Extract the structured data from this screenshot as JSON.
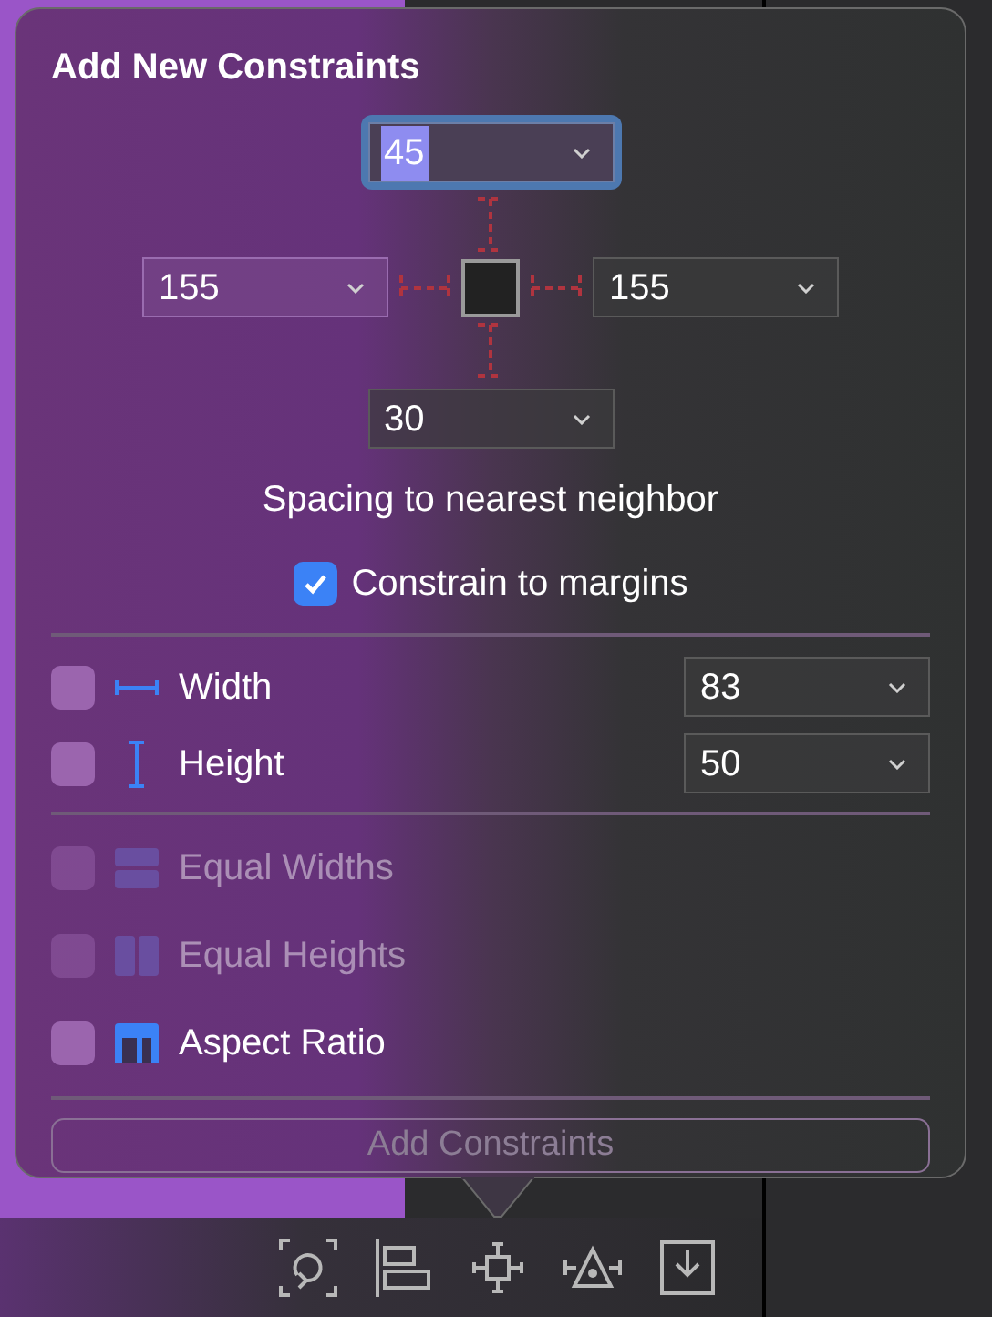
{
  "popover": {
    "title": "Add New Constraints",
    "spacing": {
      "top": {
        "value": "45",
        "focused": true
      },
      "left": {
        "value": "155",
        "focused": false
      },
      "right": {
        "value": "155",
        "focused": false
      },
      "bottom": {
        "value": "30",
        "focused": false
      }
    },
    "spacing_label": "Spacing to nearest neighbor",
    "constrain_to_margins": {
      "label": "Constrain to margins",
      "checked": true
    },
    "size_rows": [
      {
        "kind": "width",
        "label": "Width",
        "value": "83",
        "checked": false
      },
      {
        "kind": "height",
        "label": "Height",
        "value": "50",
        "checked": false
      }
    ],
    "equal_rows": [
      {
        "kind": "equal-widths",
        "label": "Equal Widths",
        "checked": false,
        "disabled": true
      },
      {
        "kind": "equal-heights",
        "label": "Equal Heights",
        "checked": false,
        "disabled": true
      },
      {
        "kind": "aspect-ratio",
        "label": "Aspect Ratio",
        "checked": false,
        "disabled": false
      }
    ],
    "add_button": {
      "label": "Add Constraints",
      "disabled": true
    }
  }
}
